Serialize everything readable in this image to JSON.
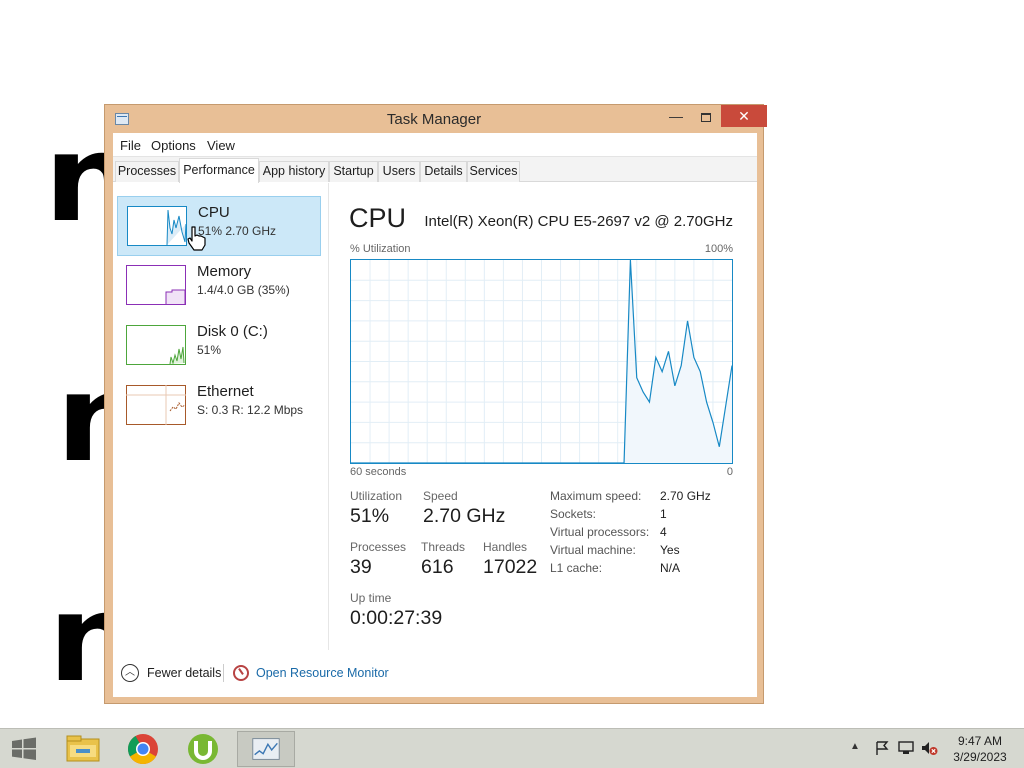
{
  "desktop": {
    "scribble_text": "n"
  },
  "window": {
    "title": "Task Manager",
    "close_glyph": "✕",
    "min_glyph": "—"
  },
  "menu": [
    "File",
    "Options",
    "View"
  ],
  "tabs": [
    "Processes",
    "Performance",
    "App history",
    "Startup",
    "Users",
    "Details",
    "Services"
  ],
  "active_tab": "Performance",
  "resources": [
    {
      "name": "CPU",
      "sub": "51%  2.70 GHz",
      "color": "#1789c5",
      "icon": "cpu-thumbnail"
    },
    {
      "name": "Memory",
      "sub": "1.4/4.0 GB (35%)",
      "color": "#8b2fb6",
      "icon": "memory-thumbnail"
    },
    {
      "name": "Disk 0 (C:)",
      "sub": "51%",
      "color": "#4da63b",
      "icon": "disk-thumbnail"
    },
    {
      "name": "Ethernet",
      "sub": "S: 0.3  R: 12.2 Mbps",
      "color": "#a7592a",
      "icon": "ethernet-thumbnail"
    }
  ],
  "detail": {
    "title": "CPU",
    "model": "Intel(R) Xeon(R) CPU E5-2697 v2 @ 2.70GHz",
    "y_label": "% Utilization",
    "y_max_label": "100%",
    "x_left_label": "60 seconds",
    "x_right_label": "0",
    "stats": {
      "utilization_label": "Utilization",
      "utilization": "51%",
      "speed_label": "Speed",
      "speed": "2.70 GHz",
      "processes_label": "Processes",
      "processes": "39",
      "threads_label": "Threads",
      "threads": "616",
      "handles_label": "Handles",
      "handles": "17022",
      "uptime_label": "Up time",
      "uptime": "0:00:27:39"
    },
    "specs": [
      {
        "label": "Maximum speed:",
        "value": "2.70 GHz"
      },
      {
        "label": "Sockets:",
        "value": "1"
      },
      {
        "label": "Virtual processors:",
        "value": "4"
      },
      {
        "label": "Virtual machine:",
        "value": "Yes"
      },
      {
        "label": "L1 cache:",
        "value": "N/A"
      }
    ]
  },
  "chart_data": {
    "type": "area",
    "x_range_seconds": [
      60,
      0
    ],
    "y_range_percent": [
      0,
      100
    ],
    "x": [
      60,
      17,
      16,
      15,
      14,
      13,
      12,
      11,
      10,
      9,
      8,
      7,
      6,
      5,
      4,
      3,
      2,
      1,
      0
    ],
    "values": [
      0,
      0,
      100,
      42,
      35,
      30,
      52,
      45,
      55,
      38,
      48,
      70,
      52,
      45,
      30,
      20,
      8,
      28,
      48
    ],
    "color": "#1789c5",
    "grid": true
  },
  "footer": {
    "fewer_details": "Fewer details",
    "open_resmon": "Open Resource Monitor"
  },
  "taskbar": {
    "apps": [
      "file-explorer-icon",
      "chrome-icon",
      "utorrent-icon",
      "task-manager-icon"
    ],
    "time": "9:47 AM",
    "date": "3/29/2023"
  }
}
